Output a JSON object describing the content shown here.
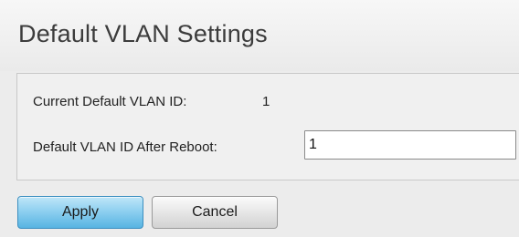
{
  "page": {
    "title": "Default VLAN Settings"
  },
  "settings": {
    "current_label": "Current Default VLAN ID:",
    "current_value": "1",
    "after_reboot_label": "Default VLAN ID After Reboot:",
    "after_reboot_value": "1"
  },
  "buttons": {
    "apply_label": "Apply",
    "cancel_label": "Cancel"
  },
  "colors": {
    "apply_button": "#8fd0f0",
    "cancel_button": "#e4e4e4",
    "title_text": "#3c3c3c"
  }
}
